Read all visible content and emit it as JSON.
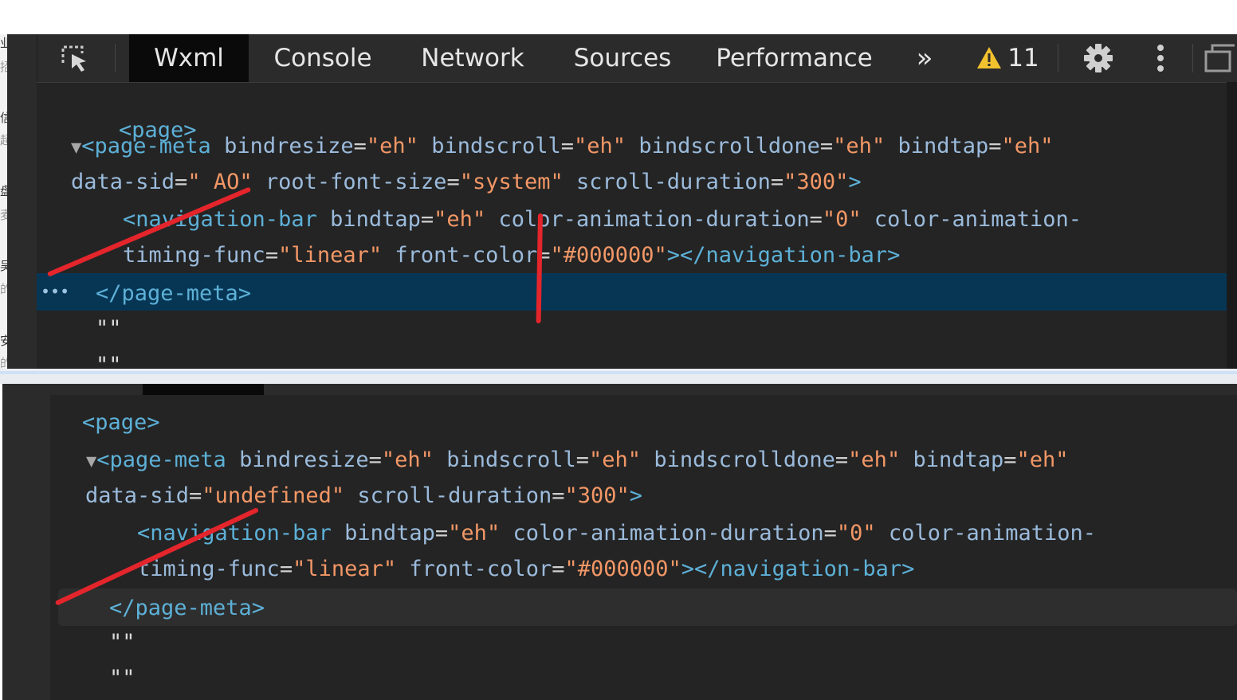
{
  "toolbar": {
    "tabs": [
      "Wxml",
      "Console",
      "Network",
      "Sources",
      "Performance"
    ],
    "active_tab": "Wxml",
    "more_label": "»",
    "warning_count": "11",
    "icons": [
      "inspect-element-icon",
      "chevrons-right-icon",
      "warning-icon",
      "gear-icon",
      "kebab-menu-icon",
      "undock-icon"
    ]
  },
  "background_glyphs": [
    "业",
    "招",
    "信",
    "超",
    "盘",
    "麦",
    "吴",
    "的",
    "安",
    "的"
  ],
  "top": {
    "line1": "<page>",
    "line2": {
      "open": "<page-meta",
      "attrs": [
        {
          "name": "bindresize",
          "value": "\"eh\""
        },
        {
          "name": "bindscroll",
          "value": "\"eh\""
        },
        {
          "name": "bindscrolldone",
          "value": "\"eh\""
        },
        {
          "name": "bindtap",
          "value": "\"eh\""
        }
      ]
    },
    "line3": {
      "attrs": [
        {
          "name": "data-sid",
          "value": "\" AO\""
        },
        {
          "name": "root-font-size",
          "value": "\"system\""
        },
        {
          "name": "scroll-duration",
          "value": "\"300\""
        }
      ],
      "close": ">"
    },
    "line4": {
      "open": "<navigation-bar",
      "attrs": [
        {
          "name": "bindtap",
          "value": "\"eh\""
        },
        {
          "name": "color-animation-duration",
          "value": "\"0\""
        }
      ],
      "tail": "color-animation-"
    },
    "line5": {
      "attrs": [
        {
          "name": "timing-func",
          "value": "\"linear\""
        },
        {
          "name": "front-color",
          "value": "\"#000000\""
        }
      ],
      "close": "></navigation-bar>"
    },
    "dots": "•••",
    "line6": "</page-meta>",
    "line7": "\"\"",
    "line8": "\"\""
  },
  "bottom": {
    "line1": "<page>",
    "line2": {
      "open": "<page-meta",
      "attrs": [
        {
          "name": "bindresize",
          "value": "\"eh\""
        },
        {
          "name": "bindscroll",
          "value": "\"eh\""
        },
        {
          "name": "bindscrolldone",
          "value": "\"eh\""
        },
        {
          "name": "bindtap",
          "value": "\"eh\""
        }
      ]
    },
    "line3": {
      "attrs": [
        {
          "name": "data-sid",
          "value": "\"undefined\""
        },
        {
          "name": "scroll-duration",
          "value": "\"300\""
        }
      ],
      "close": ">"
    },
    "line4": {
      "open": "<navigation-bar",
      "attrs": [
        {
          "name": "bindtap",
          "value": "\"eh\""
        },
        {
          "name": "color-animation-duration",
          "value": "\"0\""
        }
      ],
      "tail": "color-animation-"
    },
    "line5": {
      "attrs": [
        {
          "name": "timing-func",
          "value": "\"linear\""
        },
        {
          "name": "front-color",
          "value": "\"#000000\""
        }
      ],
      "close": "></navigation-bar>"
    },
    "line6": "</page-meta>",
    "line7": "\"\"",
    "line8": "\"\""
  },
  "colors": {
    "panel_bg": "#242424",
    "tag": "#5db0d7",
    "attr_name": "#9bbbdc",
    "attr_value": "#f29766",
    "selected_row": "#073655",
    "annotation": "#e4252c",
    "warning": "#f2c12e"
  }
}
